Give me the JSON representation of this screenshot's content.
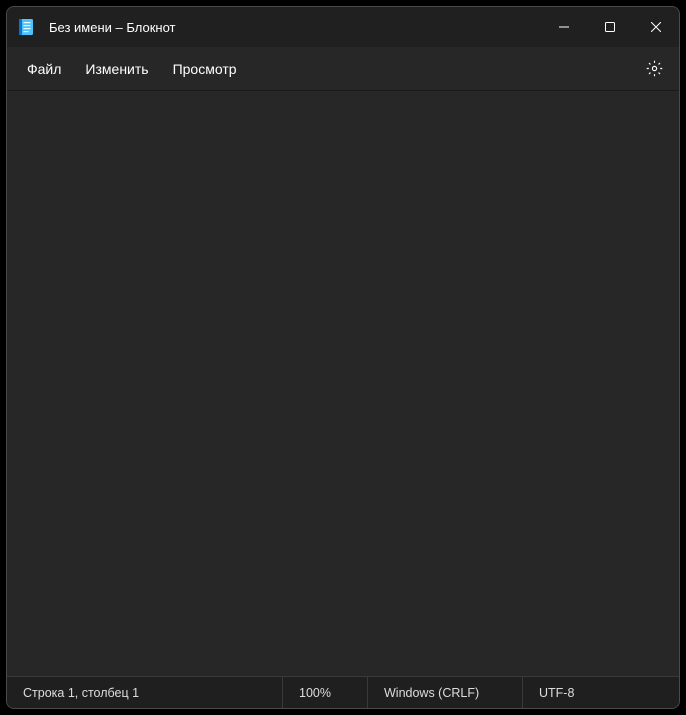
{
  "titlebar": {
    "title": "Без имени – Блокнот"
  },
  "menu": {
    "file": "Файл",
    "edit": "Изменить",
    "view": "Просмотр"
  },
  "editor": {
    "content": ""
  },
  "status": {
    "position": "Строка 1, столбец 1",
    "zoom": "100%",
    "line_ending": "Windows (CRLF)",
    "encoding": "UTF-8"
  },
  "icons": {
    "minimize": "minimize-icon",
    "maximize": "maximize-icon",
    "close": "close-icon",
    "settings": "gear-icon",
    "app": "notepad-icon"
  }
}
